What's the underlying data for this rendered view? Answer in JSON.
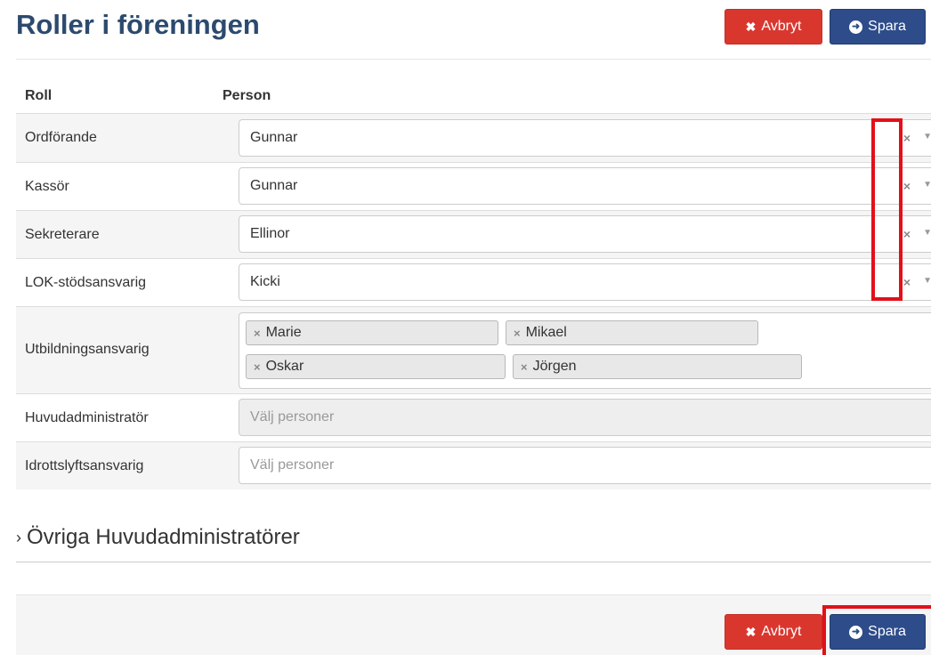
{
  "page": {
    "title": "Roller i föreningen"
  },
  "actions": {
    "cancel_label": "Avbryt",
    "save_label": "Spara"
  },
  "table": {
    "headers": {
      "role": "Roll",
      "person": "Person"
    },
    "rows": [
      {
        "role": "Ordförande",
        "value": "Gunnar"
      },
      {
        "role": "Kassör",
        "value": "Gunnar"
      },
      {
        "role": "Sekreterare",
        "value": "Ellinor"
      },
      {
        "role": "LOK-stödsansvarig",
        "value": "Kicki"
      },
      {
        "role": "Utbildningsansvarig",
        "tags": [
          "Marie",
          "Mikael",
          "Oskar",
          "Jörgen"
        ]
      },
      {
        "role": "Huvudadministratör",
        "placeholder": "Välj personer",
        "disabled": true
      },
      {
        "role": "Idrottslyftsansvarig",
        "placeholder": "Välj personer"
      }
    ]
  },
  "section": {
    "title": "Övriga Huvudadministratörer"
  },
  "icons": {
    "clear": "×",
    "caret": "▼",
    "cancel": "✖",
    "save": "➜",
    "chevron": "›"
  },
  "colors": {
    "highlight": "#e2101a",
    "cancel": "#d9372e",
    "save": "#2e4c8a",
    "title": "#2c4a6e"
  }
}
